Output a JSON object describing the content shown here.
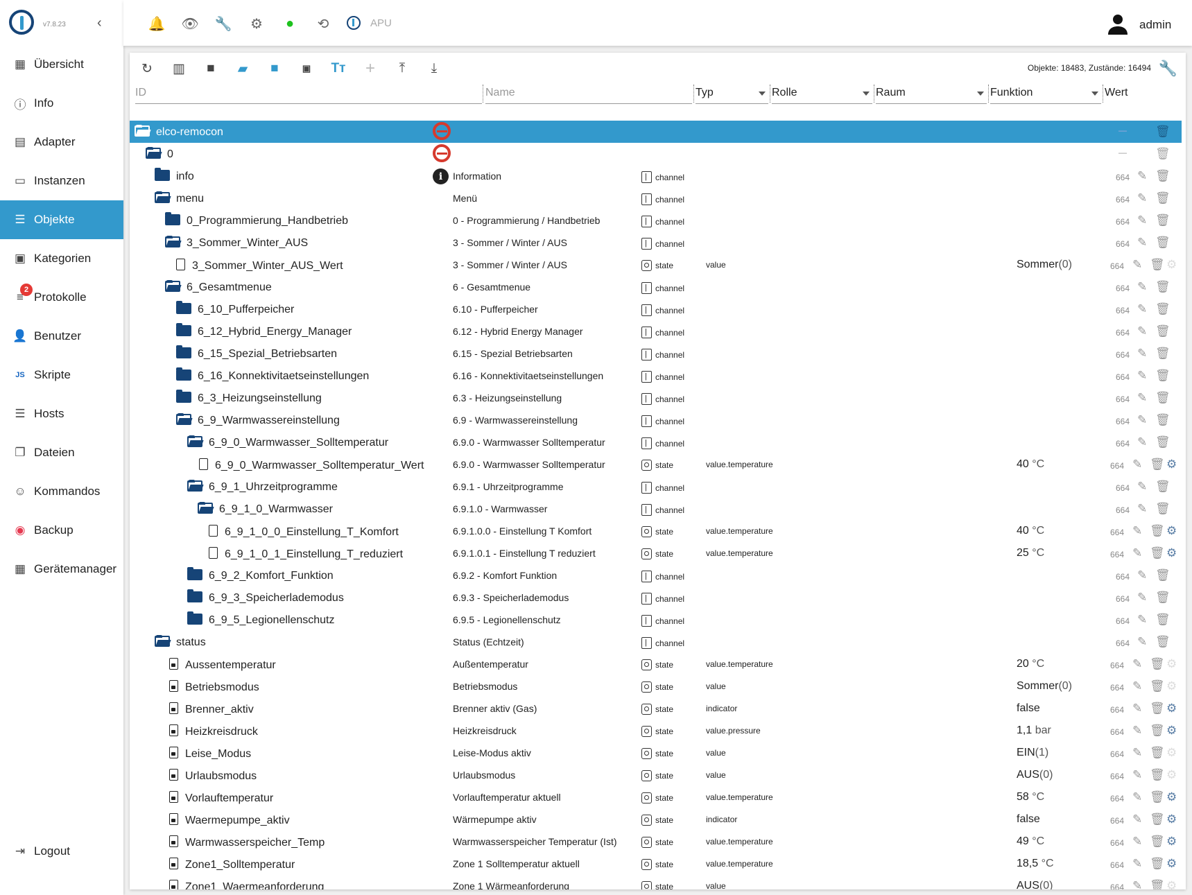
{
  "app": {
    "version": "v7.8.23",
    "user": "admin",
    "apu_label": "APU"
  },
  "sidebar": {
    "items": [
      {
        "label": "Übersicht",
        "icon": "grid-icon"
      },
      {
        "label": "Info",
        "icon": "info-icon"
      },
      {
        "label": "Adapter",
        "icon": "store-icon"
      },
      {
        "label": "Instanzen",
        "icon": "instances-icon"
      },
      {
        "label": "Objekte",
        "icon": "list-icon",
        "active": true
      },
      {
        "label": "Kategorien",
        "icon": "categories-icon"
      },
      {
        "label": "Protokolle",
        "icon": "log-icon",
        "badge": "2"
      },
      {
        "label": "Benutzer",
        "icon": "user-icon"
      },
      {
        "label": "Skripte",
        "icon": "js-icon"
      },
      {
        "label": "Hosts",
        "icon": "hosts-icon"
      },
      {
        "label": "Dateien",
        "icon": "files-icon"
      },
      {
        "label": "Kommandos",
        "icon": "commands-icon"
      },
      {
        "label": "Backup",
        "icon": "backup-icon"
      },
      {
        "label": "Gerätemanager",
        "icon": "device-manager-icon"
      }
    ],
    "logout": "Logout"
  },
  "toolbar": {
    "counts": "Objekte: 18483, Zustände: 16494"
  },
  "filters": {
    "id": "ID",
    "name": "Name",
    "type": "Typ",
    "role": "Rolle",
    "room": "Raum",
    "function": "Funktion",
    "value": "Wert"
  },
  "rows": [
    {
      "id": "elco-remocon",
      "name": "",
      "type": "",
      "role": "",
      "value": "",
      "acl": "—"
    },
    {
      "id": "0",
      "name": "",
      "type": "",
      "role": "",
      "value": "",
      "acl": "—"
    },
    {
      "id": "info",
      "name": "Information",
      "type": "channel",
      "role": "",
      "value": "",
      "acl": "664"
    },
    {
      "id": "menu",
      "name": "Menü",
      "type": "channel",
      "role": "",
      "value": "",
      "acl": "664"
    },
    {
      "id": "0_Programmierung_Handbetrieb",
      "name": "0 - Programmierung / Handbetrieb",
      "type": "channel",
      "role": "",
      "value": "",
      "acl": "664"
    },
    {
      "id": "3_Sommer_Winter_AUS",
      "name": "3 - Sommer / Winter / AUS",
      "type": "channel",
      "role": "",
      "value": "",
      "acl": "664"
    },
    {
      "id": "3_Sommer_Winter_AUS_Wert",
      "name": "3 - Sommer / Winter / AUS",
      "type": "state",
      "role": "value",
      "value": "Sommer",
      "unit": "(0)",
      "acl": "664"
    },
    {
      "id": "6_Gesamtmenue",
      "name": "6 - Gesamtmenue",
      "type": "channel",
      "role": "",
      "value": "",
      "acl": "664"
    },
    {
      "id": "6_10_Pufferpeicher",
      "name": "6.10 - Pufferpeicher",
      "type": "channel",
      "role": "",
      "value": "",
      "acl": "664"
    },
    {
      "id": "6_12_Hybrid_Energy_Manager",
      "name": "6.12 - Hybrid Energy Manager",
      "type": "channel",
      "role": "",
      "value": "",
      "acl": "664"
    },
    {
      "id": "6_15_Spezial_Betriebsarten",
      "name": "6.15 - Spezial Betriebsarten",
      "type": "channel",
      "role": "",
      "value": "",
      "acl": "664"
    },
    {
      "id": "6_16_Konnektivitaetseinstellungen",
      "name": "6.16 - Konnektivitaetseinstellungen",
      "type": "channel",
      "role": "",
      "value": "",
      "acl": "664"
    },
    {
      "id": "6_3_Heizungseinstellung",
      "name": "6.3 - Heizungseinstellung",
      "type": "channel",
      "role": "",
      "value": "",
      "acl": "664"
    },
    {
      "id": "6_9_Warmwassereinstellung",
      "name": "6.9 - Warmwassereinstellung",
      "type": "channel",
      "role": "",
      "value": "",
      "acl": "664"
    },
    {
      "id": "6_9_0_Warmwasser_Solltemperatur",
      "name": "6.9.0 - Warmwasser Solltemperatur",
      "type": "channel",
      "role": "",
      "value": "",
      "acl": "664"
    },
    {
      "id": "6_9_0_Warmwasser_Solltemperatur_Wert",
      "name": "6.9.0 - Warmwasser Solltemperatur",
      "type": "state",
      "role": "value.temperature",
      "value": "40",
      "unit": " °C",
      "acl": "664"
    },
    {
      "id": "6_9_1_Uhrzeitprogramme",
      "name": "6.9.1 - Uhrzeitprogramme",
      "type": "channel",
      "role": "",
      "value": "",
      "acl": "664"
    },
    {
      "id": "6_9_1_0_Warmwasser",
      "name": "6.9.1.0 - Warmwasser",
      "type": "channel",
      "role": "",
      "value": "",
      "acl": "664"
    },
    {
      "id": "6_9_1_0_0_Einstellung_T_Komfort",
      "name": "6.9.1.0.0 - Einstellung T Komfort",
      "type": "state",
      "role": "value.temperature",
      "value": "40",
      "unit": " °C",
      "acl": "664"
    },
    {
      "id": "6_9_1_0_1_Einstellung_T_reduziert",
      "name": "6.9.1.0.1 - Einstellung T reduziert",
      "type": "state",
      "role": "value.temperature",
      "value": "25",
      "unit": " °C",
      "acl": "664"
    },
    {
      "id": "6_9_2_Komfort_Funktion",
      "name": "6.9.2 - Komfort Funktion",
      "type": "channel",
      "role": "",
      "value": "",
      "acl": "664"
    },
    {
      "id": "6_9_3_Speicherlademodus",
      "name": "6.9.3 - Speicherlademodus",
      "type": "channel",
      "role": "",
      "value": "",
      "acl": "664"
    },
    {
      "id": "6_9_5_Legionellenschutz",
      "name": "6.9.5 - Legionellenschutz",
      "type": "channel",
      "role": "",
      "value": "",
      "acl": "664"
    },
    {
      "id": "status",
      "name": "Status (Echtzeit)",
      "type": "channel",
      "role": "",
      "value": "",
      "acl": "664"
    },
    {
      "id": "Aussentemperatur",
      "name": "Außentemperatur",
      "type": "state",
      "role": "value.temperature",
      "value": "20",
      "unit": " °C",
      "acl": "664"
    },
    {
      "id": "Betriebsmodus",
      "name": "Betriebsmodus",
      "type": "state",
      "role": "value",
      "value": "Sommer",
      "unit": "(0)",
      "acl": "664"
    },
    {
      "id": "Brenner_aktiv",
      "name": "Brenner aktiv (Gas)",
      "type": "state",
      "role": "indicator",
      "value": "false",
      "unit": "",
      "acl": "664"
    },
    {
      "id": "Heizkreisdruck",
      "name": "Heizkreisdruck",
      "type": "state",
      "role": "value.pressure",
      "value": "1,1",
      "unit": " bar",
      "acl": "664"
    },
    {
      "id": "Leise_Modus",
      "name": "Leise-Modus aktiv",
      "type": "state",
      "role": "value",
      "value": "EIN",
      "unit": "(1)",
      "acl": "664"
    },
    {
      "id": "Urlaubsmodus",
      "name": "Urlaubsmodus",
      "type": "state",
      "role": "value",
      "value": "AUS",
      "unit": "(0)",
      "acl": "664"
    },
    {
      "id": "Vorlauftemperatur",
      "name": "Vorlauftemperatur aktuell",
      "type": "state",
      "role": "value.temperature",
      "value": "58",
      "unit": " °C",
      "acl": "664"
    },
    {
      "id": "Waermepumpe_aktiv",
      "name": "Wärmepumpe aktiv",
      "type": "state",
      "role": "indicator",
      "value": "false",
      "unit": "",
      "acl": "664"
    },
    {
      "id": "Warmwasserspeicher_Temp",
      "name": "Warmwasserspeicher Temperatur (Ist)",
      "type": "state",
      "role": "value.temperature",
      "value": "49",
      "unit": " °C",
      "acl": "664"
    },
    {
      "id": "Zone1_Solltemperatur",
      "name": "Zone 1 Solltemperatur aktuell",
      "type": "state",
      "role": "value.temperature",
      "value": "18,5",
      "unit": " °C",
      "acl": "664"
    },
    {
      "id": "Zone1_Waermeanforderung",
      "name": "Zone 1 Wärmeanforderung",
      "type": "state",
      "role": "value",
      "value": "AUS",
      "unit": "(0)",
      "acl": "664"
    }
  ],
  "colors": {
    "accent": "#3399CC",
    "folder": "#164477",
    "adapter": "#d63a2e"
  }
}
